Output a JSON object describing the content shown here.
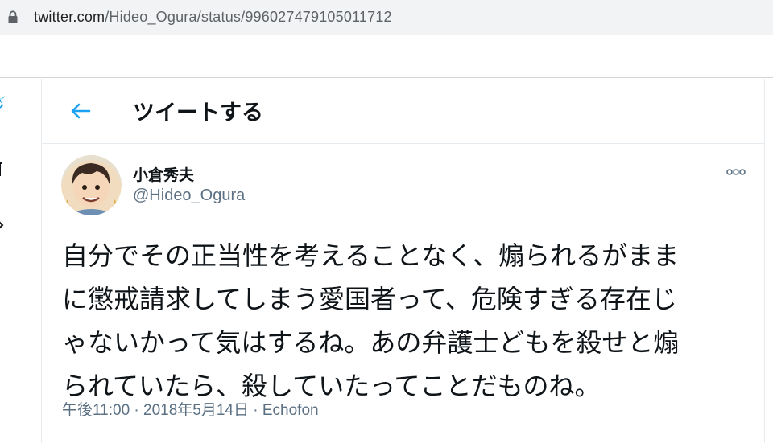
{
  "browser": {
    "url_host": "twitter.com",
    "url_path": "/Hideo_Ogura/status/996027479105011712"
  },
  "colors": {
    "accent": "#1da1f2",
    "text_primary": "#0f1419",
    "text_secondary": "#5b7083",
    "border": "#e6ecf0"
  },
  "header": {
    "back_icon": "arrow-left-icon",
    "title": "ツイートする"
  },
  "tweet": {
    "author": {
      "display_name": "小倉秀夫",
      "handle": "@Hideo_Ogura",
      "avatar": "caricature-avatar"
    },
    "more_icon": "ellipsis-icon",
    "text_lines": [
      "自分でその正当性を考えることなく、煽られるがまま",
      "に懲戒請求してしまう愛国者って、危険すぎる存在じ",
      "ゃないかって気はするね。あの弁護士どもを殺せと煽",
      "られていたら、殺していたってことだものね。"
    ],
    "meta": "午後11:00 · 2018年5月14日 · Echofon"
  }
}
